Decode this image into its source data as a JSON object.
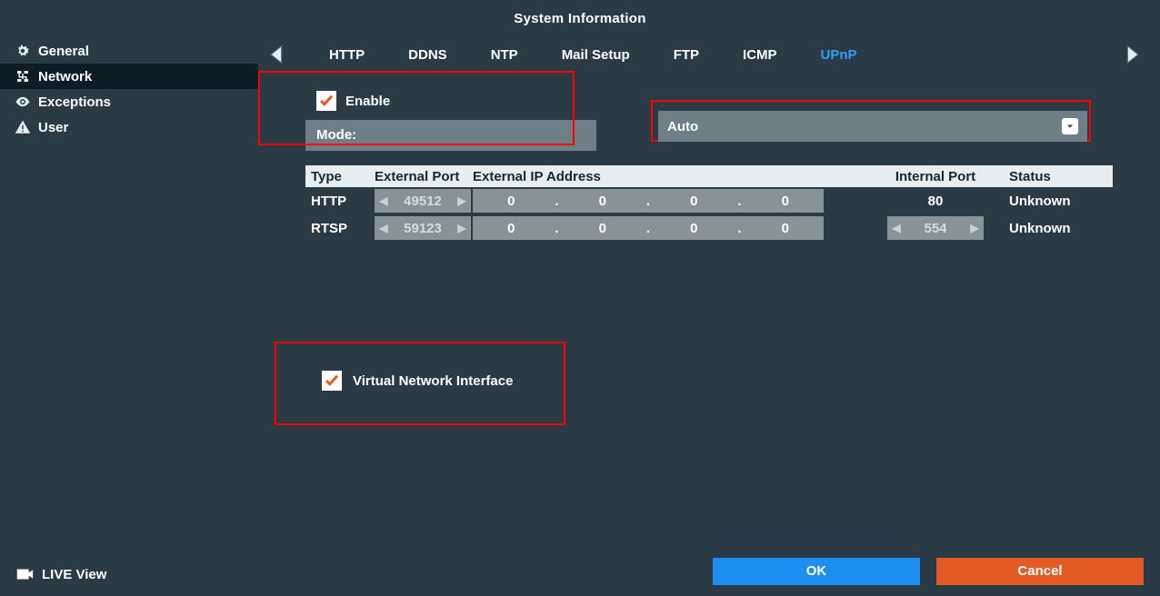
{
  "header": {
    "title": "System Information"
  },
  "sidebar": {
    "items": [
      {
        "label": "General"
      },
      {
        "label": "Network"
      },
      {
        "label": "Exceptions"
      },
      {
        "label": "User"
      }
    ],
    "live_view": "LIVE View"
  },
  "tabs": {
    "items": [
      {
        "label": "HTTP"
      },
      {
        "label": "DDNS"
      },
      {
        "label": "NTP"
      },
      {
        "label": "Mail Setup"
      },
      {
        "label": "FTP"
      },
      {
        "label": "ICMP"
      },
      {
        "label": "UPnP"
      }
    ]
  },
  "upnp": {
    "enable_label": "Enable",
    "enable_checked": true,
    "mode_label": "Mode:",
    "mode_value": "Auto"
  },
  "table": {
    "headers": {
      "type": "Type",
      "ext_port": "External Port",
      "ext_ip": "External IP Address",
      "int_port": "Internal Port",
      "status": "Status"
    },
    "rows": [
      {
        "type": "HTTP",
        "ext_port": "49512",
        "ip": [
          "0",
          "0",
          "0",
          "0"
        ],
        "int_port": "80",
        "status": "Unknown",
        "int_spinner": false
      },
      {
        "type": "RTSP",
        "ext_port": "59123",
        "ip": [
          "0",
          "0",
          "0",
          "0"
        ],
        "int_port": "554",
        "status": "Unknown",
        "int_spinner": true
      }
    ]
  },
  "vni": {
    "label": "Virtual Network Interface",
    "checked": true
  },
  "buttons": {
    "ok": "OK",
    "cancel": "Cancel"
  }
}
